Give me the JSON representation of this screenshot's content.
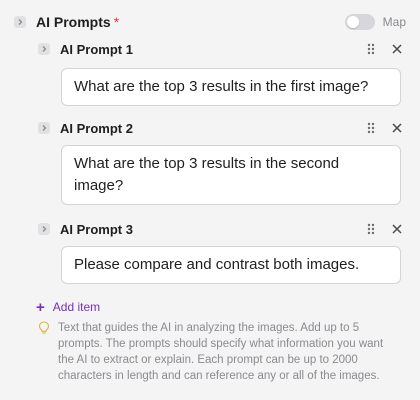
{
  "section": {
    "title": "AI Prompts",
    "required_mark": "*",
    "toggle_label": "Map",
    "toggle_on": false
  },
  "prompts": [
    {
      "label": "AI Prompt 1",
      "value": "What are the top 3 results in the first image?"
    },
    {
      "label": "AI Prompt 2",
      "value": "What are the top 3 results in the second image?"
    },
    {
      "label": "AI Prompt 3",
      "value": "Please compare and contrast both images."
    }
  ],
  "add_item_label": "Add item",
  "help_text": "Text that guides the AI in analyzing the images. Add up to 5 prompts. The prompts should specify what information you want the AI to extract or explain. Each prompt can be up to 2000 characters in length and can reference any or all of the images.",
  "icons": {
    "expand": "chevron-right-icon",
    "drag": "drag-handle-icon",
    "remove": "close-icon",
    "add": "plus-icon",
    "hint": "lightbulb-icon"
  },
  "colors": {
    "accent": "#7b2cbf",
    "required": "#e03a3a",
    "muted_text": "#8a8a90",
    "background": "#f4f4f5"
  }
}
